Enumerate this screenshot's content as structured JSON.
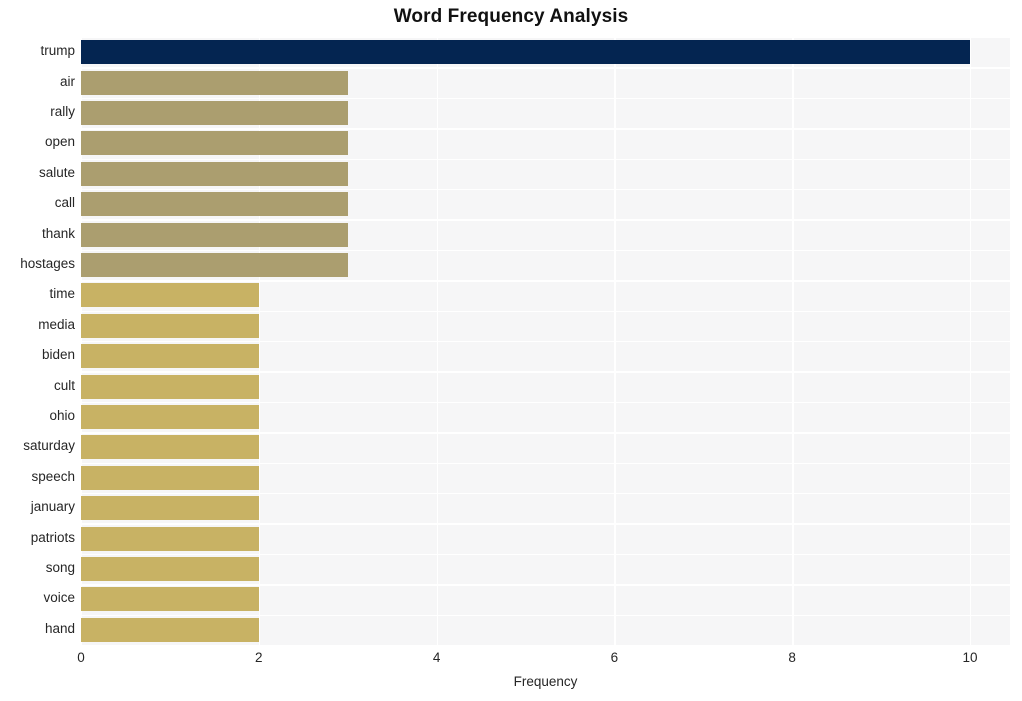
{
  "chart_data": {
    "type": "bar",
    "orientation": "horizontal",
    "title": "Word Frequency Analysis",
    "xlabel": "Frequency",
    "ylabel": "",
    "xlim": [
      0,
      10.45
    ],
    "xticks": [
      0,
      2,
      4,
      6,
      8,
      10
    ],
    "xtick_labels": [
      "0",
      "2",
      "4",
      "6",
      "8",
      "10"
    ],
    "grid": true,
    "legend": "none",
    "categories": [
      "trump",
      "air",
      "rally",
      "open",
      "salute",
      "call",
      "thank",
      "hostages",
      "time",
      "media",
      "biden",
      "cult",
      "ohio",
      "saturday",
      "speech",
      "january",
      "patriots",
      "song",
      "voice",
      "hand"
    ],
    "values": [
      10,
      3,
      3,
      3,
      3,
      3,
      3,
      3,
      2,
      2,
      2,
      2,
      2,
      2,
      2,
      2,
      2,
      2,
      2,
      2
    ],
    "bar_colors": [
      "#042551",
      "#ab9e6f",
      "#ab9e6f",
      "#ab9e6f",
      "#ab9e6f",
      "#ab9e6f",
      "#ab9e6f",
      "#ab9e6f",
      "#c8b264",
      "#c8b264",
      "#c8b264",
      "#c8b264",
      "#c8b264",
      "#c8b264",
      "#c8b264",
      "#c8b264",
      "#c8b264",
      "#c8b264",
      "#c8b264",
      "#c8b264"
    ]
  },
  "style": {
    "figure_background": "#ffffff",
    "plot_background": "#f6f6f7",
    "gridline_color": "#ffffff",
    "text_color": "#262626",
    "title_color": "#111111"
  }
}
